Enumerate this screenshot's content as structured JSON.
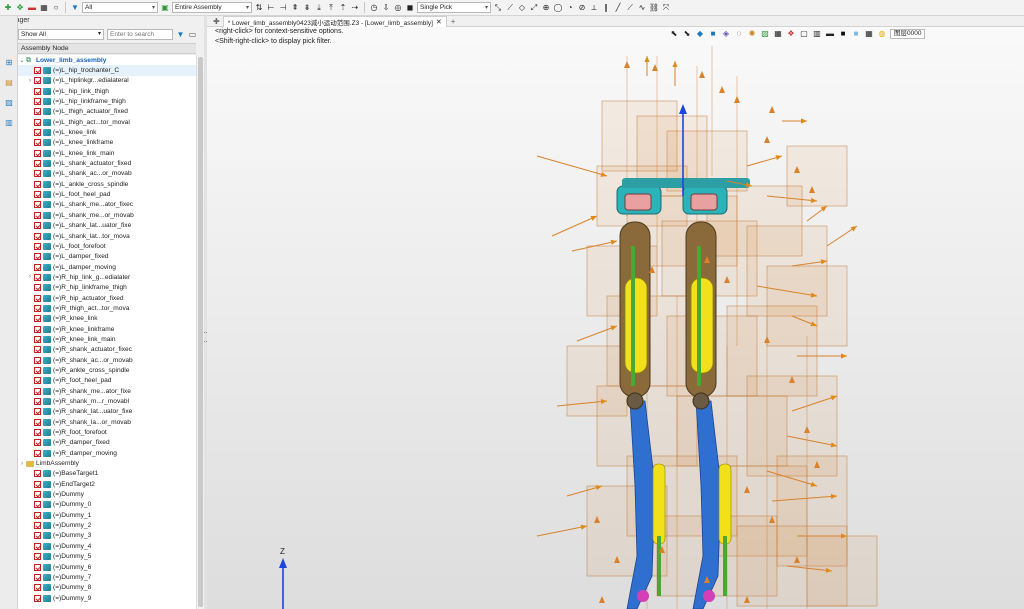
{
  "toolbar": {
    "filter_value": "All",
    "scope_value": "Entire Assembly",
    "pick_value": "Single Pick"
  },
  "manager": {
    "title": "Manager",
    "show_value": "Show All",
    "search_placeholder": "Enter to search",
    "column_header": "Assembly Node"
  },
  "tree": {
    "root": "Lower_limb_assembly",
    "items": [
      "(=)L_hip_trochanter_C",
      "(=)L_hiplinkgr...edialateral",
      "(=)L_hip_link_thigh",
      "(=)L_hip_linkframe_thigh",
      "(=)L_thigh_actuator_fixed",
      "(=)L_thigh_act...tor_moval",
      "(=)L_knee_link",
      "(=)L_knee_linkframe",
      "(=)L_knee_link_main",
      "(=)L_shank_actuator_fixed",
      "(=)L_shank_ac...or_movab",
      "(=)L_ankle_cross_spindle",
      "(=)L_foot_heel_pad",
      "(=)L_shank_me...ator_fixec",
      "(=)L_shank_me...or_movab",
      "(=)L_shank_lat...uator_fixe",
      "(=)L_shank_lat...tor_mova",
      "(=)L_foot_forefoot",
      "(=)L_damper_fixed",
      "(=)L_damper_moving",
      "(=)R_hip_link_g...edialater",
      "(=)R_hip_linkframe_thigh",
      "(=)R_hip_actuator_fixed",
      "(=)R_thigh_act...tor_mova",
      "(=)R_knee_link",
      "(=)R_knee_linkframe",
      "(=)R_knee_link_main",
      "(=)R_shank_actuator_fixec",
      "(=)R_shank_ac...or_movab",
      "(=)R_ankle_cross_spindle",
      "(=)R_foot_heel_pad",
      "(=)R_shank_me...ator_fixe",
      "(=)R_shank_m...r_movabl",
      "(=)R_shank_lat...uator_fixe",
      "(=)R_shank_la...or_movab",
      "(=)R_foot_forefoot",
      "(=)R_damper_fixed",
      "(=)R_damper_moving"
    ],
    "limb_folder": "LimbAssembly",
    "limb_items": [
      "(=)BaseTarget1",
      "(=)EndTarget2",
      "(=)Dummy",
      "(=)Dummy_0",
      "(=)Dummy_1",
      "(=)Dummy_2",
      "(=)Dummy_3",
      "(=)Dummy_4",
      "(=)Dummy_5",
      "(=)Dummy_6",
      "(=)Dummy_7",
      "(=)Dummy_8",
      "(=)Dummy_9"
    ]
  },
  "viewport": {
    "tab_label": "* Lower_limb_assembly0423減小运动范围.Z3 - [Lower_limb_assembly]",
    "hint_line1": "<right-click> for context-sensitive options.",
    "hint_line2": "<Shift-right-click> to display pick filter.",
    "layer_value": "图层0000",
    "triad_axis": "Z"
  },
  "colors": {
    "accent": "#1a78c2",
    "frame_orange": "#d9822b",
    "link_yellow": "#f2e01a",
    "link_blue": "#2f6fd0",
    "link_green": "#4aa832",
    "joint_cyan": "#2ab3b8"
  }
}
